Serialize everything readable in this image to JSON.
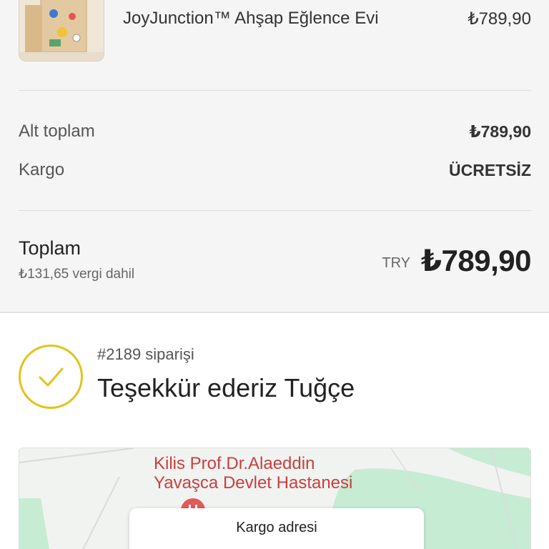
{
  "order_summary": {
    "product": {
      "name": "JoyJunction™ Ahşap Eğlence Evi",
      "price": "₺789,90"
    },
    "subtotal": {
      "label": "Alt toplam",
      "value": "₺789,90"
    },
    "shipping": {
      "label": "Kargo",
      "value": "ÜCRETSİZ"
    },
    "total": {
      "label": "Toplam",
      "tax_note": "₺131,65 vergi dahil",
      "currency": "TRY",
      "amount": "₺789,90"
    }
  },
  "confirmation": {
    "order_number": "#2189 siparişi",
    "thanks": "Teşekkür ederiz Tuğçe"
  },
  "map": {
    "place_line1": "Kilis Prof.Dr.Alaeddin",
    "place_line2": "Yavaşca Devlet Hastanesi",
    "address_card_title": "Kargo adresi"
  },
  "colors": {
    "accent_check": "#e4c21c",
    "map_place_text": "#c8403f"
  }
}
